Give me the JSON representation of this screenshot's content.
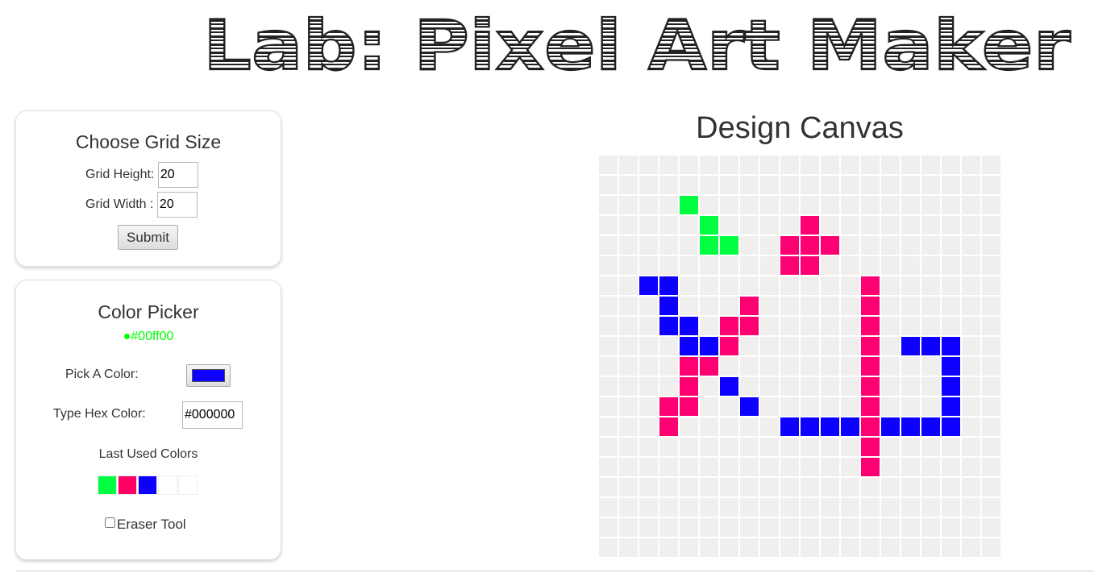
{
  "header": {
    "title": "Lab: Pixel Art Maker"
  },
  "grid_size": {
    "heading": "Choose Grid Size",
    "height_label": "Grid Height:",
    "height_value": "20",
    "width_label": "Grid Width :",
    "width_value": "20",
    "submit_label": "Submit"
  },
  "color_picker": {
    "heading": "Color Picker",
    "current_color_dot": "●",
    "current_color_text": "#00ff00",
    "current_color": "#00ff00",
    "pick_label": "Pick A Color:",
    "picked_color": "#0d00ff",
    "hex_label": "Type Hex Color:",
    "hex_value": "#000000",
    "recent_heading": "Last Used Colors",
    "recent_colors": [
      "#00ff41",
      "#ff0066",
      "#0d00ff",
      "#ffffff",
      "#ffffff"
    ],
    "eraser_label": "Eraser Tool",
    "eraser_checked": false
  },
  "canvas": {
    "title": "Design Canvas",
    "rows": 20,
    "cols": 20,
    "empty_color": "#f0efee",
    "palette": {
      "G": "#00ff41",
      "P": "#ff0073",
      "B": "#0d00ff"
    },
    "pixels": [
      "....................",
      "....................",
      "....G...............",
      ".....G....P.........",
      ".....GG..PPP........",
      ".........PP.........",
      "..BB.........P......",
      "...B...P.....P......",
      "...BB.PP.....P......",
      "....BBP......P.BBB..",
      "....PP.......P...B..",
      "....P.B......P...B..",
      "...PP..B.....P...B..",
      "...P.....BBBBPBBBB..",
      ".............P......",
      ".............P......",
      "....................",
      "....................",
      "....................",
      "...................."
    ]
  }
}
